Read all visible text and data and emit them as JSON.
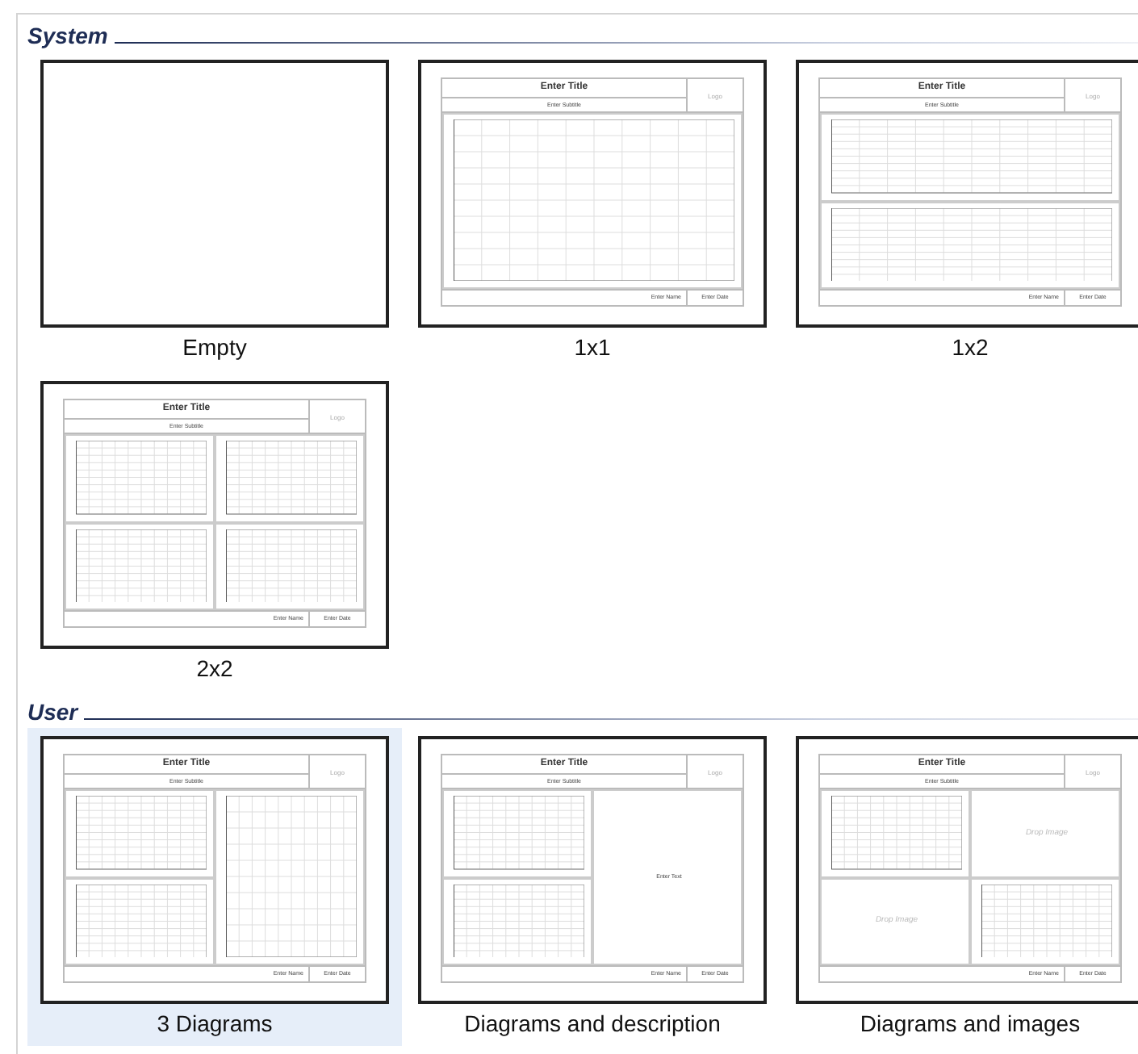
{
  "sections": [
    {
      "title": "System",
      "templates": [
        {
          "name": "Empty",
          "selected": false,
          "kind": "empty"
        },
        {
          "name": "1x1",
          "selected": false,
          "kind": "single",
          "sheet": {
            "title": "Enter Title",
            "subtitle": "Enter Subtitle",
            "logo": "Logo",
            "author": "Enter Name",
            "date": "Enter Date",
            "panels": [
              {
                "kind": "chart"
              }
            ]
          }
        },
        {
          "name": "1x2",
          "selected": false,
          "kind": "stack",
          "sheet": {
            "title": "Enter Title",
            "subtitle": "Enter Subtitle",
            "logo": "Logo",
            "author": "Enter Name",
            "date": "Enter Date",
            "panels": [
              {
                "kind": "chart"
              },
              {
                "kind": "chart"
              }
            ]
          }
        },
        {
          "name": "2x2",
          "selected": false,
          "kind": "grid",
          "sheet": {
            "title": "Enter Title",
            "subtitle": "Enter Subtitle",
            "logo": "Logo",
            "author": "Enter Name",
            "date": "Enter Date",
            "panels": [
              {
                "kind": "chart"
              },
              {
                "kind": "chart"
              },
              {
                "kind": "chart"
              },
              {
                "kind": "chart"
              }
            ]
          }
        }
      ]
    },
    {
      "title": "User",
      "templates": [
        {
          "name": "3 Diagrams",
          "selected": true,
          "kind": "split",
          "sheet": {
            "title": "Enter Title",
            "subtitle": "Enter Subtitle",
            "logo": "Logo",
            "author": "Enter Name",
            "date": "Enter Date",
            "panels": [
              {
                "kind": "chart"
              },
              {
                "kind": "chart"
              },
              {
                "kind": "chart"
              }
            ]
          }
        },
        {
          "name": "Diagrams and description",
          "selected": false,
          "kind": "split",
          "sheet": {
            "title": "Enter Title",
            "subtitle": "Enter Subtitle",
            "logo": "Logo",
            "author": "Enter Name",
            "date": "Enter Date",
            "panels": [
              {
                "kind": "chart"
              },
              {
                "kind": "chart"
              },
              {
                "kind": "text",
                "text": "Enter Text"
              }
            ]
          }
        },
        {
          "name": "Diagrams and images",
          "selected": false,
          "kind": "grid",
          "sheet": {
            "title": "Enter Title",
            "subtitle": "Enter Subtitle",
            "logo": "Logo",
            "author": "Enter Name",
            "date": "Enter Date",
            "panels": [
              {
                "kind": "chart"
              },
              {
                "kind": "image",
                "text": "Drop Image"
              },
              {
                "kind": "image",
                "text": "Drop Image"
              },
              {
                "kind": "chart"
              }
            ]
          }
        }
      ]
    }
  ]
}
